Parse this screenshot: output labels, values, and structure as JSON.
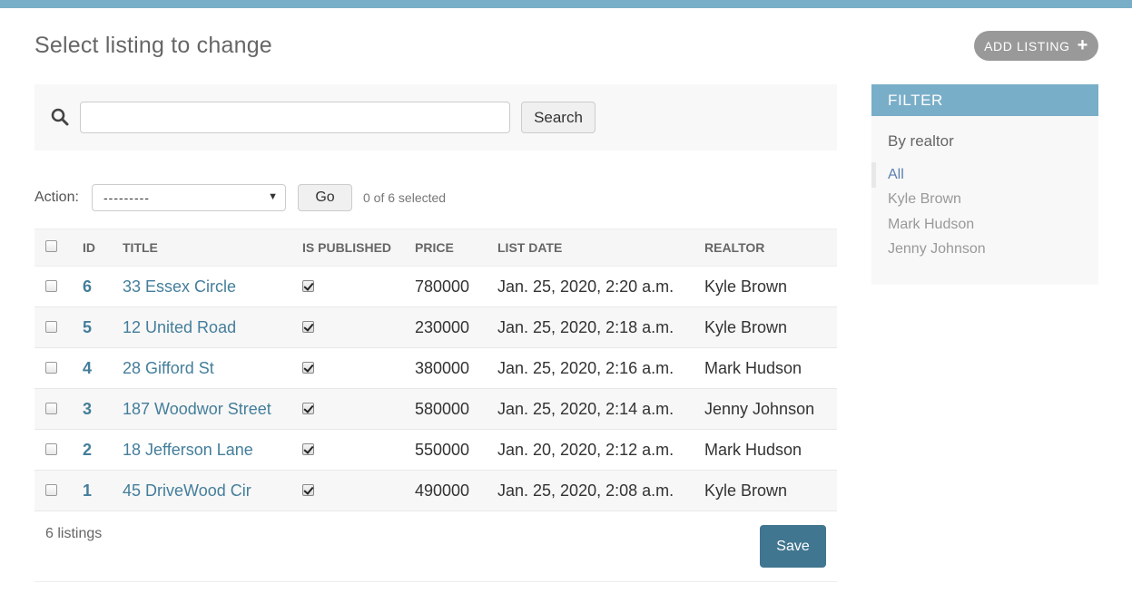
{
  "header": {
    "title": "Select listing to change",
    "add_button_label": "ADD LISTING"
  },
  "search": {
    "value": "",
    "placeholder": "",
    "button_label": "Search"
  },
  "actions": {
    "label": "Action:",
    "selected_option": "---------",
    "go_label": "Go",
    "selection_status": "0 of 6 selected"
  },
  "table": {
    "columns": [
      "ID",
      "TITLE",
      "IS PUBLISHED",
      "PRICE",
      "LIST DATE",
      "REALTOR"
    ],
    "rows": [
      {
        "id": "6",
        "title": "33 Essex Circle",
        "published": true,
        "price": "780000",
        "list_date": "Jan. 25, 2020, 2:20 a.m.",
        "realtor": "Kyle Brown"
      },
      {
        "id": "5",
        "title": "12 United Road",
        "published": true,
        "price": "230000",
        "list_date": "Jan. 25, 2020, 2:18 a.m.",
        "realtor": "Kyle Brown"
      },
      {
        "id": "4",
        "title": "28 Gifford St",
        "published": true,
        "price": "380000",
        "list_date": "Jan. 25, 2020, 2:16 a.m.",
        "realtor": "Mark Hudson"
      },
      {
        "id": "3",
        "title": "187 Woodwor Street",
        "published": true,
        "price": "580000",
        "list_date": "Jan. 25, 2020, 2:14 a.m.",
        "realtor": "Jenny Johnson"
      },
      {
        "id": "2",
        "title": "18 Jefferson Lane",
        "published": true,
        "price": "550000",
        "list_date": "Jan. 20, 2020, 2:12 a.m.",
        "realtor": "Mark Hudson"
      },
      {
        "id": "1",
        "title": "45 DriveWood Cir",
        "published": true,
        "price": "490000",
        "list_date": "Jan. 25, 2020, 2:08 a.m.",
        "realtor": "Kyle Brown"
      }
    ]
  },
  "footer": {
    "count_label": "6 listings",
    "save_label": "Save"
  },
  "filter": {
    "title": "FILTER",
    "subtitle": "By realtor",
    "options": [
      "All",
      "Kyle Brown",
      "Mark Hudson",
      "Jenny Johnson"
    ],
    "selected_option": "All"
  },
  "colors": {
    "accent": "#79aec8",
    "link": "#447e9b",
    "save_button": "#417690"
  }
}
